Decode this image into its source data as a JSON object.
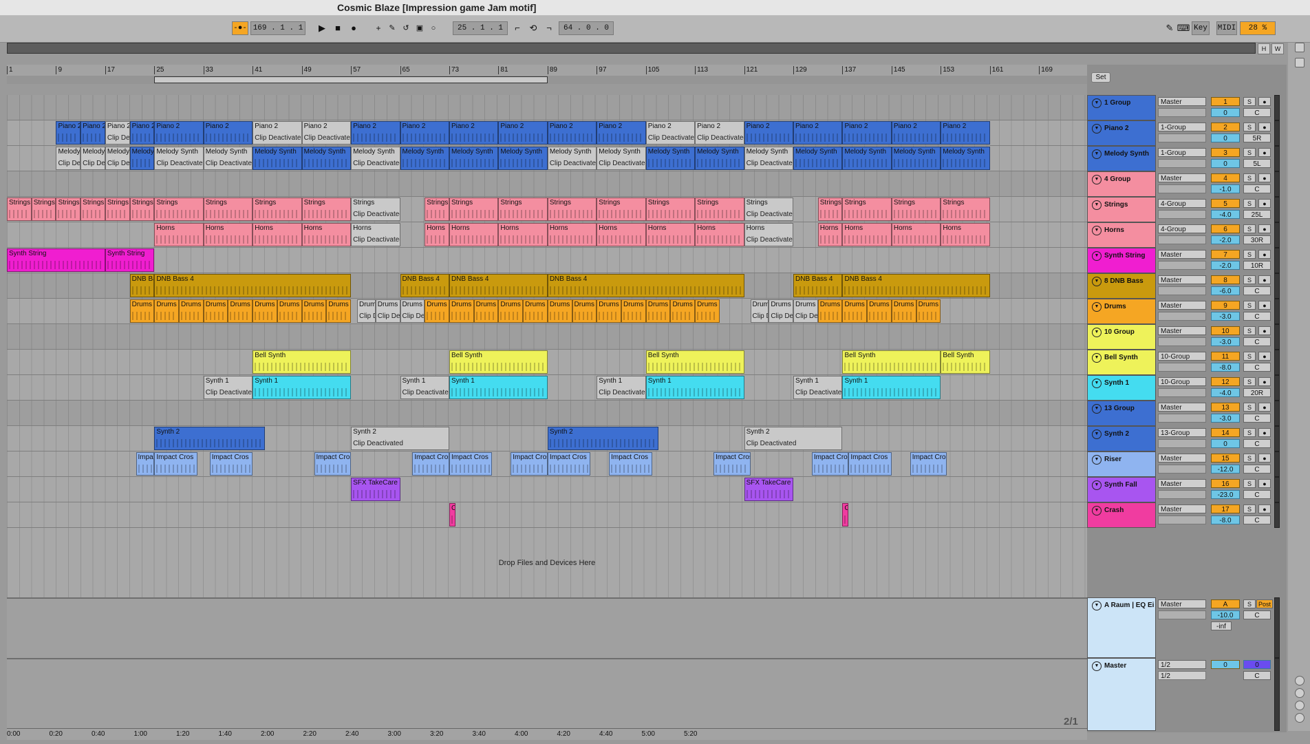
{
  "window": {
    "title": "Cosmic Blaze  [Impression game Jam motif]"
  },
  "transport": {
    "follow_label": "-●-",
    "position": "169 .  1 .  1",
    "loop_start": "25 .  1 .  1",
    "loop_length": "64 .  0 .  0",
    "key_label": "Key",
    "midi_label": "MIDI",
    "cpu": "28 %"
  },
  "overview": {
    "h_label": "H",
    "w_label": "W"
  },
  "ruler": {
    "bars": [
      "1",
      "9",
      "17",
      "25",
      "33",
      "41",
      "49",
      "57",
      "65",
      "73",
      "81",
      "89",
      "97",
      "105",
      "113",
      "121",
      "129",
      "137",
      "145",
      "153",
      "161",
      "169"
    ]
  },
  "timeline": {
    "times": [
      "0:00",
      "0:20",
      "0:40",
      "1:00",
      "1:20",
      "1:40",
      "2:00",
      "2:20",
      "2:40",
      "3:00",
      "3:20",
      "3:40",
      "4:00",
      "4:20",
      "4:40",
      "5:00",
      "5:20"
    ]
  },
  "arrangement": {
    "drop_hint": "Drop Files and Devices Here",
    "pager": "2/1",
    "clips": {
      "piano": "Piano 2",
      "melody": "Melody Synth",
      "strings": "Strings",
      "horns": "Horns",
      "synthstring": "Synth String",
      "dnb": "DNB Bass 4",
      "drums": "Drums",
      "bell": "Bell Synth",
      "synth1": "Synth 1",
      "synth2": "Synth 2",
      "riser": "Impact Cros",
      "sfx": "SFX TakeCare",
      "crash": "C",
      "deactivated": "Clip Deactivated"
    }
  },
  "mixer": {
    "set_label": "Set",
    "tracks": [
      {
        "name": "1 Group",
        "route": "Master",
        "num": "1",
        "vol": "0",
        "pan": "C",
        "color": "#3d6fd1",
        "group": true
      },
      {
        "name": "Piano 2",
        "route": "1-Group",
        "num": "2",
        "vol": "0",
        "pan": "5R",
        "color": "#3d6fd1"
      },
      {
        "name": "Melody Synth",
        "route": "1-Group",
        "num": "3",
        "vol": "0",
        "pan": "5L",
        "color": "#3d6fd1"
      },
      {
        "name": "4 Group",
        "route": "Master",
        "num": "4",
        "vol": "-1.0",
        "pan": "C",
        "color": "#f48ea0",
        "group": true
      },
      {
        "name": "Strings",
        "route": "4-Group",
        "num": "5",
        "vol": "-4.0",
        "pan": "25L",
        "color": "#f48ea0"
      },
      {
        "name": "Horns",
        "route": "4-Group",
        "num": "6",
        "vol": "-2.0",
        "pan": "30R",
        "color": "#f48ea0"
      },
      {
        "name": "Synth String",
        "route": "Master",
        "num": "7",
        "vol": "-2.0",
        "pan": "10R",
        "color": "#f01ed0"
      },
      {
        "name": "8 DNB Bass",
        "route": "Master",
        "num": "8",
        "vol": "-6.0",
        "pan": "C",
        "color": "#c99a0e",
        "group": true
      },
      {
        "name": "Drums",
        "route": "Master",
        "num": "9",
        "vol": "-3.0",
        "pan": "C",
        "color": "#f5a623"
      },
      {
        "name": "10 Group",
        "route": "Master",
        "num": "10",
        "vol": "-3.0",
        "pan": "C",
        "color": "#eef25a",
        "group": true
      },
      {
        "name": "Bell Synth",
        "route": "10-Group",
        "num": "11",
        "vol": "-8.0",
        "pan": "C",
        "color": "#eef25a"
      },
      {
        "name": "Synth 1",
        "route": "10-Group",
        "num": "12",
        "vol": "-4.0",
        "pan": "20R",
        "color": "#44dcf0"
      },
      {
        "name": "13 Group",
        "route": "Master",
        "num": "13",
        "vol": "-3.0",
        "pan": "C",
        "color": "#3d6fd1",
        "group": true
      },
      {
        "name": "Synth 2",
        "route": "13-Group",
        "num": "14",
        "vol": "0",
        "pan": "C",
        "color": "#3d6fd1"
      },
      {
        "name": "Riser",
        "route": "Master",
        "num": "15",
        "vol": "-12.0",
        "pan": "C",
        "color": "#8fb4f0"
      },
      {
        "name": "Synth Fall",
        "route": "Master",
        "num": "16",
        "vol": "-23.0",
        "pan": "C",
        "color": "#a855f0"
      },
      {
        "name": "Crash",
        "route": "Master",
        "num": "17",
        "vol": "-8.0",
        "pan": "C",
        "color": "#f03ca0"
      }
    ],
    "return": {
      "name": "A Raum | EQ Ei",
      "route": "Master",
      "num": "A",
      "vol": "-10.0",
      "pan": "C",
      "post": "Post",
      "inf": "-inf"
    },
    "master": {
      "name": "Master",
      "route1": "1/2",
      "route2": "1/2",
      "num": "0",
      "vol": "0",
      "pan": "C"
    }
  },
  "colors": {
    "accent": "#f5a623",
    "volume": "#6ec6e6"
  }
}
